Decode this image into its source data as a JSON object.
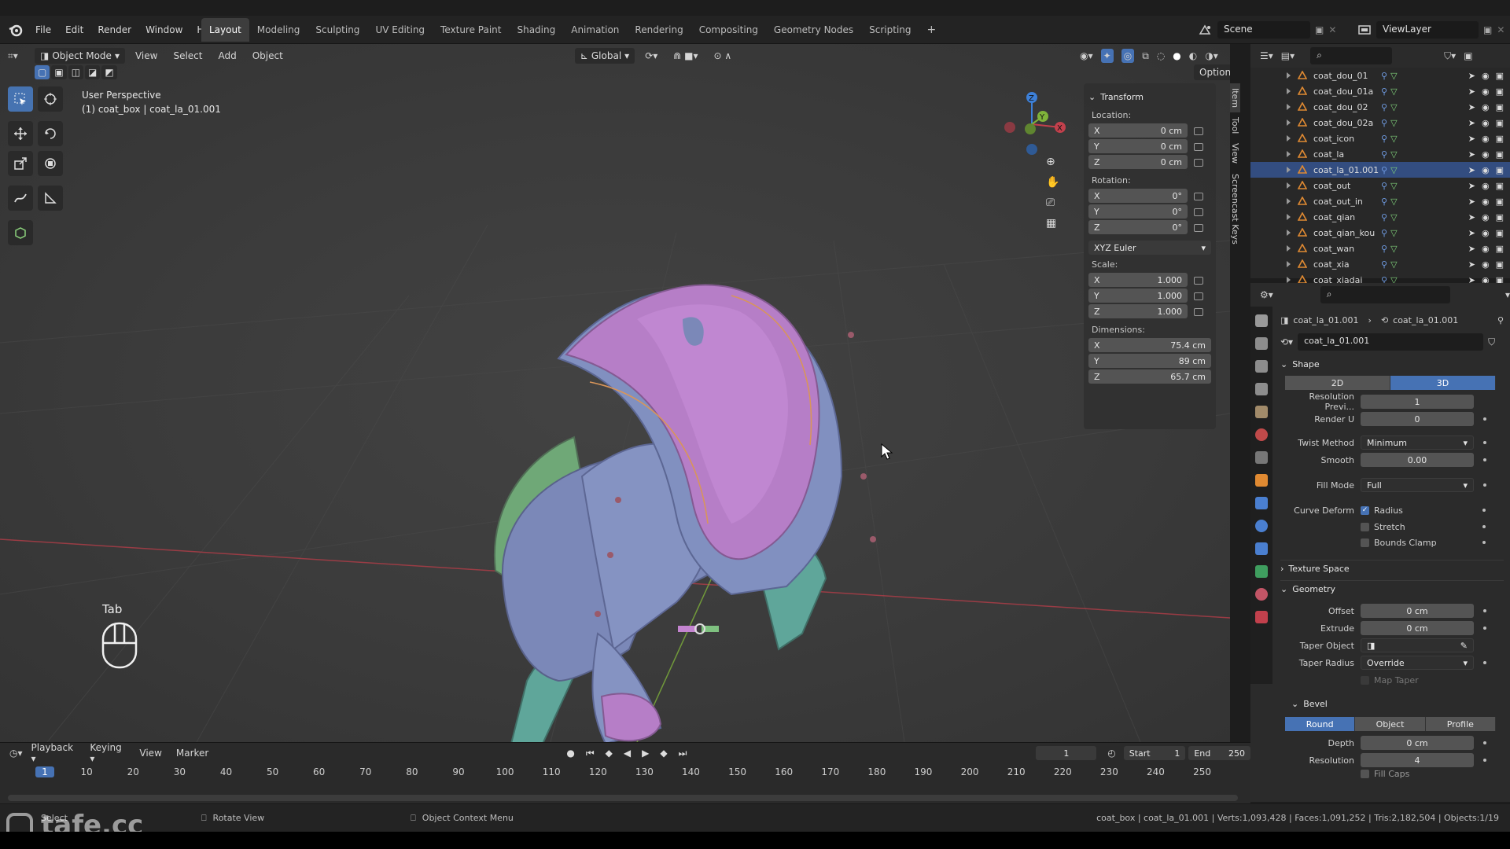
{
  "menu": [
    "File",
    "Edit",
    "Render",
    "Window",
    "Help"
  ],
  "workspaces": [
    "Layout",
    "Modeling",
    "Sculpting",
    "UV Editing",
    "Texture Paint",
    "Shading",
    "Animation",
    "Rendering",
    "Compositing",
    "Geometry Nodes",
    "Scripting"
  ],
  "scene": "Scene",
  "view_layer": "ViewLayer",
  "viewport": {
    "mode": "Object Mode",
    "menus": [
      "View",
      "Select",
      "Add",
      "Object"
    ],
    "orientation": "Global",
    "options": "Options",
    "perspective": "User Perspective",
    "object_info": "(1) coat_box | coat_la_01.001",
    "key_label": "Tab"
  },
  "npanel": {
    "section": "Transform",
    "location_label": "Location:",
    "location": [
      {
        "axis": "X",
        "v": "0 cm"
      },
      {
        "axis": "Y",
        "v": "0 cm"
      },
      {
        "axis": "Z",
        "v": "0 cm"
      }
    ],
    "rotation_label": "Rotation:",
    "rotation": [
      {
        "axis": "X",
        "v": "0°"
      },
      {
        "axis": "Y",
        "v": "0°"
      },
      {
        "axis": "Z",
        "v": "0°"
      }
    ],
    "rotation_mode": "XYZ Euler",
    "scale_label": "Scale:",
    "scale": [
      {
        "axis": "X",
        "v": "1.000"
      },
      {
        "axis": "Y",
        "v": "1.000"
      },
      {
        "axis": "Z",
        "v": "1.000"
      }
    ],
    "dimensions_label": "Dimensions:",
    "dimensions": [
      {
        "axis": "X",
        "v": "75.4 cm"
      },
      {
        "axis": "Y",
        "v": "89 cm"
      },
      {
        "axis": "Z",
        "v": "65.7 cm"
      }
    ],
    "tabs": [
      "Item",
      "Tool",
      "View",
      "Screencast Keys"
    ]
  },
  "outliner": {
    "items": [
      "coat_dou_01",
      "coat_dou_01a",
      "coat_dou_02",
      "coat_dou_02a",
      "coat_icon",
      "coat_la",
      "coat_la_01.001",
      "coat_out",
      "coat_out_in",
      "coat_qian",
      "coat_qian_kou",
      "coat_wan",
      "coat_xia",
      "coat_xiadai"
    ],
    "selected": "coat_la_01.001"
  },
  "properties": {
    "breadcrumb_object": "coat_la_01.001",
    "breadcrumb_data": "coat_la_01.001",
    "data_name": "coat_la_01.001",
    "shape": {
      "title": "Shape",
      "mode_2d": "2D",
      "mode_3d": "3D",
      "res_preview_label": "Resolution Previ...",
      "res_preview": "1",
      "render_u_label": "Render U",
      "render_u": "0",
      "twist_method_label": "Twist Method",
      "twist_method": "Minimum",
      "smooth_label": "Smooth",
      "smooth": "0.00",
      "fill_mode_label": "Fill Mode",
      "fill_mode": "Full",
      "curve_deform_label": "Curve Deform",
      "radius": "Radius",
      "stretch": "Stretch",
      "bounds_clamp": "Bounds Clamp"
    },
    "texture_space": "Texture Space",
    "geometry": {
      "title": "Geometry",
      "offset_label": "Offset",
      "offset": "0 cm",
      "extrude_label": "Extrude",
      "extrude": "0 cm",
      "taper_object_label": "Taper Object",
      "taper_radius_label": "Taper Radius",
      "taper_radius": "Override",
      "map_taper": "Map Taper"
    },
    "bevel": {
      "title": "Bevel",
      "round": "Round",
      "object": "Object",
      "profile": "Profile",
      "depth_label": "Depth",
      "depth": "0 cm",
      "resolution_label": "Resolution",
      "resolution": "4",
      "fill_caps": "Fill Caps"
    }
  },
  "timeline": {
    "menus": [
      "Playback",
      "Keying",
      "View",
      "Marker"
    ],
    "current_frame": "1",
    "start_label": "Start",
    "start": "1",
    "end_label": "End",
    "end": "250",
    "ticks": [
      "1",
      "10",
      "20",
      "30",
      "40",
      "50",
      "60",
      "70",
      "80",
      "90",
      "100",
      "110",
      "120",
      "130",
      "140",
      "150",
      "160",
      "170",
      "180",
      "190",
      "200",
      "210",
      "220",
      "230",
      "240",
      "250"
    ]
  },
  "status": {
    "select": "Select",
    "rotate": "Rotate View",
    "context": "Object Context Menu",
    "info": "coat_box | coat_la_01.001 | Verts:1,093,428 | Faces:1,091,252 | Tris:2,182,504 | Objects:1/19"
  },
  "watermark": "tafe.cc",
  "colors": {
    "accent": "#4672b4",
    "x_axis": "#c2404c",
    "y_axis": "#7fb33a",
    "z_axis": "#3d80d8",
    "jacket_blue": "#7b88b8",
    "jacket_purple": "#b67ec7",
    "jacket_green": "#6fa877",
    "jacket_teal": "#5fa69a"
  }
}
